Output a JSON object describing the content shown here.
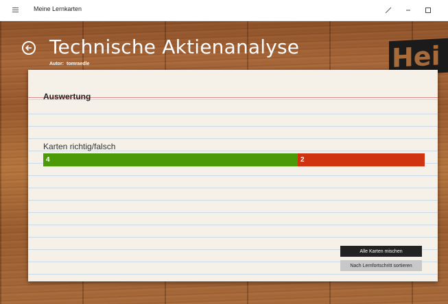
{
  "window": {
    "title": "Meine Lernkarten",
    "menu_icon": "hamburger-icon",
    "buttons": [
      "expand-icon",
      "minimize-icon",
      "maximize-icon"
    ]
  },
  "header": {
    "title": "Technische Aktienanalyse",
    "author_label": "Autor:",
    "author_name": "tomraedle",
    "back_icon": "back-arrow-icon",
    "logo_text": "Hei"
  },
  "evaluation": {
    "title": "Auswertung",
    "bar_label": "Karten richtig/falsch",
    "correct": 4,
    "wrong": 2,
    "correct_label": "4",
    "wrong_label": "2",
    "colors": {
      "correct": "#4c9a08",
      "wrong": "#d0330f"
    }
  },
  "actions": {
    "shuffle_label": "Alle Karten mischen",
    "sort_label": "Nach Lernfortschritt sortieren"
  }
}
